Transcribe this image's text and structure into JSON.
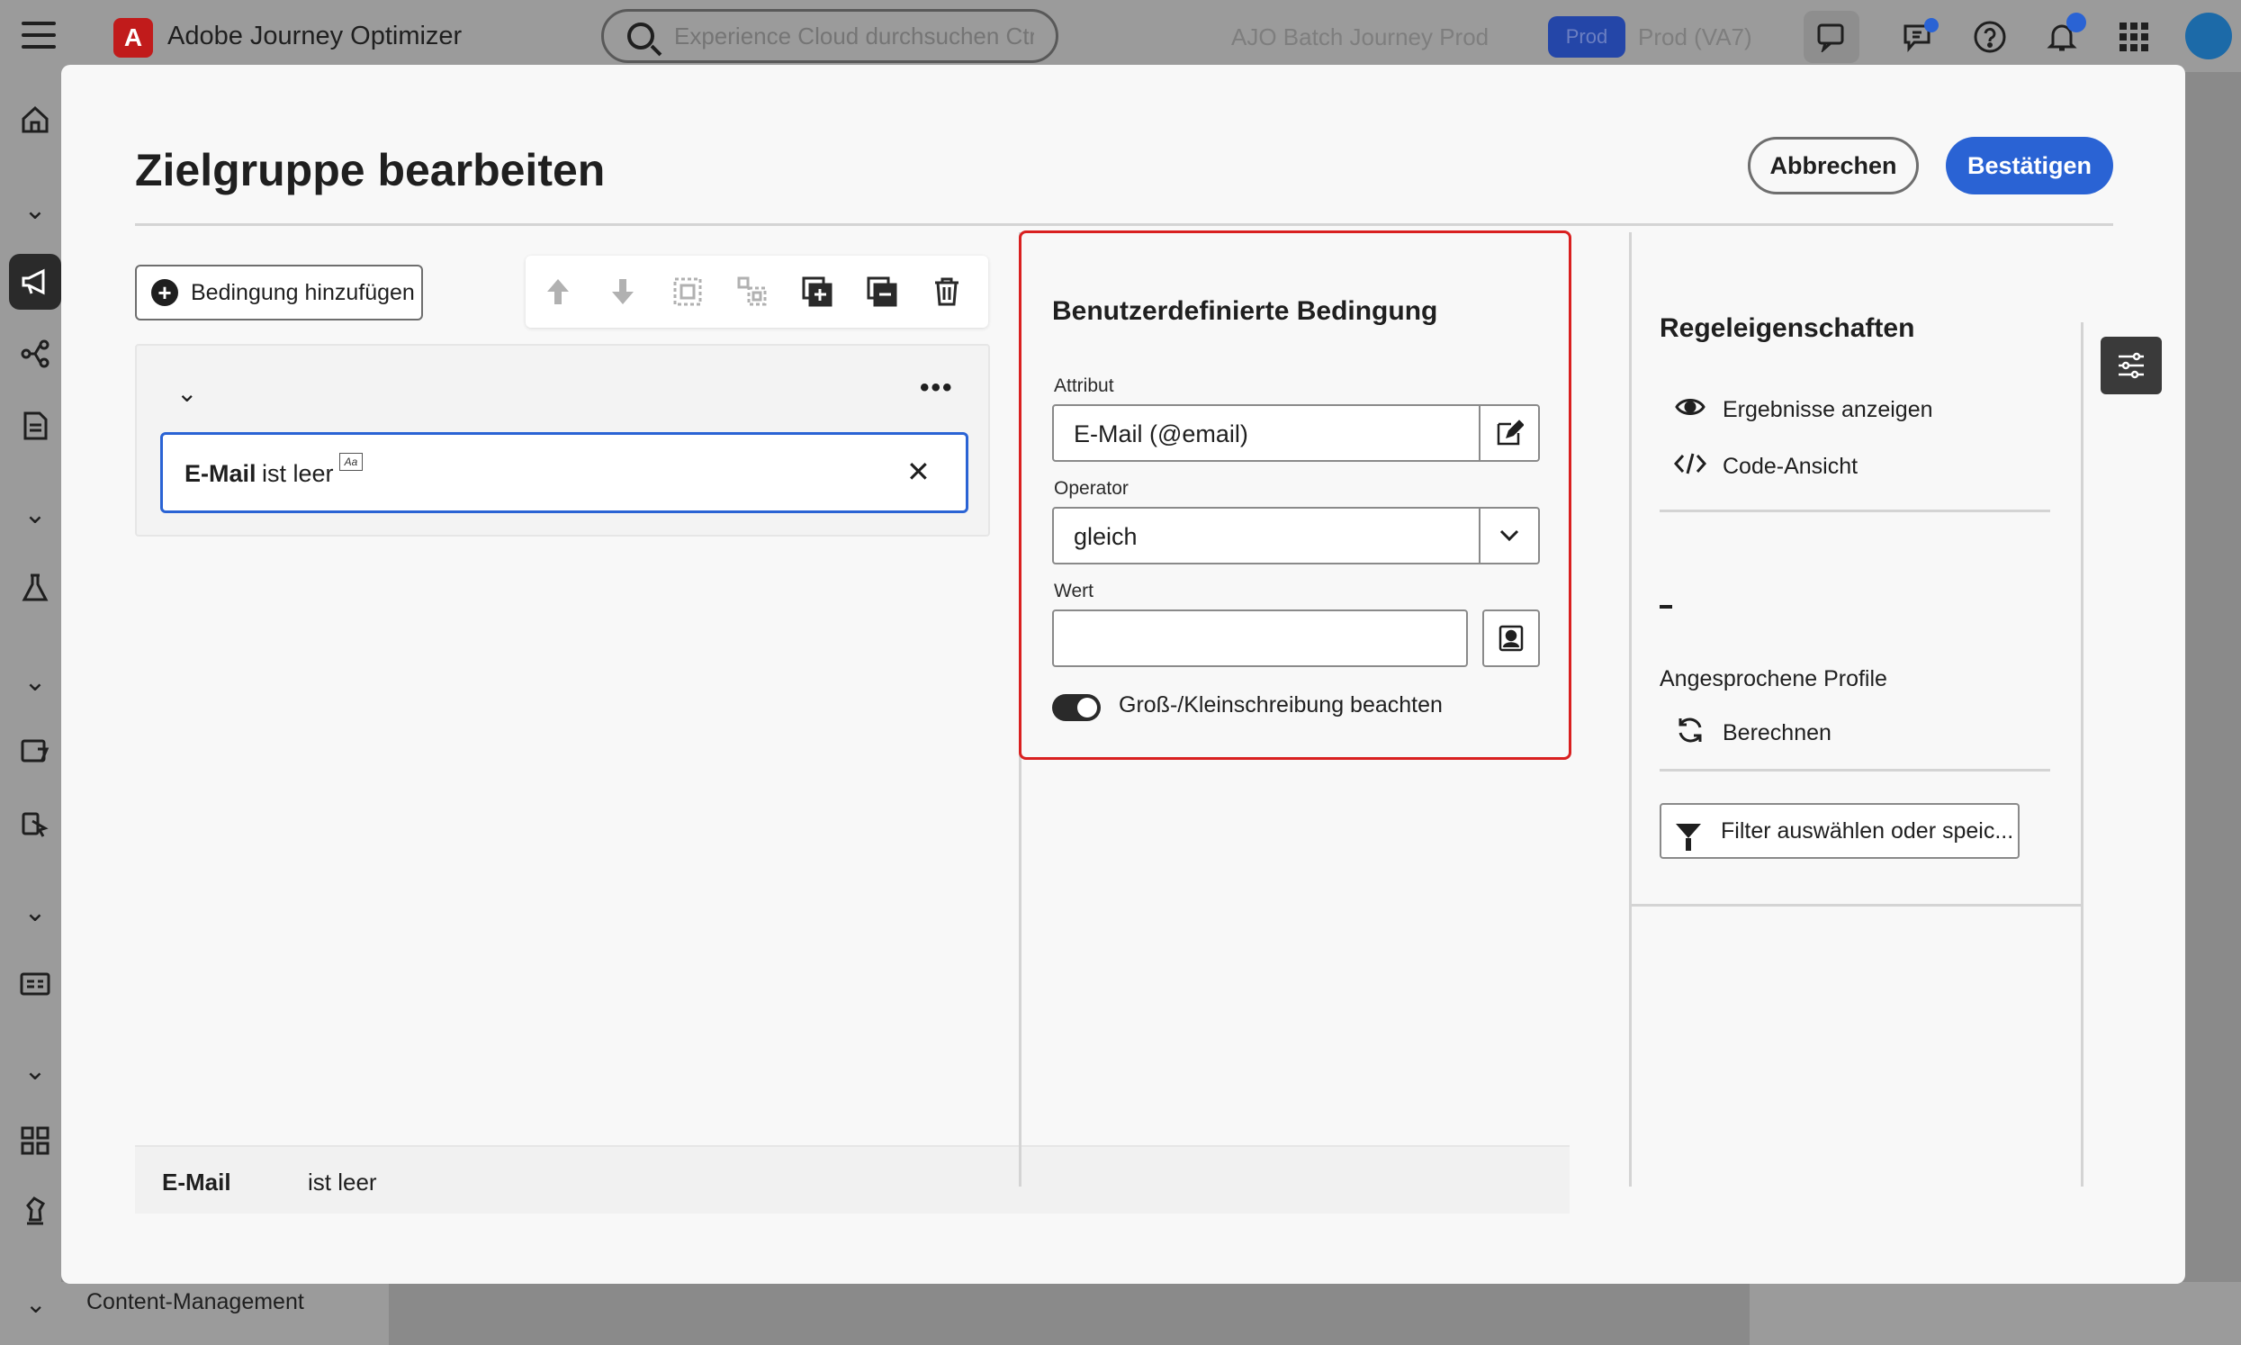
{
  "app": {
    "title": "Adobe Journey Optimizer",
    "search_placeholder": "Experience Cloud durchsuchen Ctr...",
    "sandbox_name": "AJO Batch Journey Prod",
    "env_badge": "Prod",
    "env_label": "Prod (VA7)",
    "accent_color": "#2a63d4"
  },
  "sidebar": {
    "items": [
      "home-icon",
      "chevron-down-icon",
      "megaphone-icon",
      "journey-icon",
      "document-icon",
      "chevron-down-icon",
      "flask-icon",
      "chevron-down-icon",
      "offers-icon",
      "fragments-icon",
      "chevron-down-icon",
      "card-icon",
      "chevron-down-icon",
      "apps-icon",
      "chess-icon"
    ],
    "bottom_label": "Content-Management"
  },
  "modal": {
    "title": "Zielgruppe bearbeiten",
    "cancel_label": "Abbrechen",
    "confirm_label": "Bestätigen"
  },
  "builder": {
    "add_condition_label": "Bedingung hinzufügen",
    "toolbar_icons": [
      "arrow-up-icon",
      "arrow-down-icon",
      "group-icon",
      "ungroup-icon",
      "duplicate-icon",
      "remove-group-icon",
      "trash-icon"
    ],
    "condition": {
      "attribute": "E-Mail",
      "operator_text": "ist leer",
      "case_badge": "Aa"
    },
    "summary": {
      "attribute": "E-Mail",
      "operator_text": "ist leer"
    }
  },
  "custom_condition": {
    "title": "Benutzerdefinierte Bedingung",
    "attribute_label": "Attribut",
    "attribute_value": "E-Mail (@email)",
    "operator_label": "Operator",
    "operator_value": "gleich",
    "value_label": "Wert",
    "value_value": "",
    "case_sensitive_label": "Groß-/Kleinschreibung beachten",
    "case_sensitive_on": true,
    "highlight_color": "#d92020"
  },
  "rule_properties": {
    "title": "Regeleigenschaften",
    "show_results_label": "Ergebnisse anzeigen",
    "code_view_label": "Code-Ansicht",
    "profile_count": "-",
    "profiles_label": "Angesprochene Profile",
    "calculate_label": "Berechnen",
    "filter_label": "Filter auswählen oder speic..."
  }
}
